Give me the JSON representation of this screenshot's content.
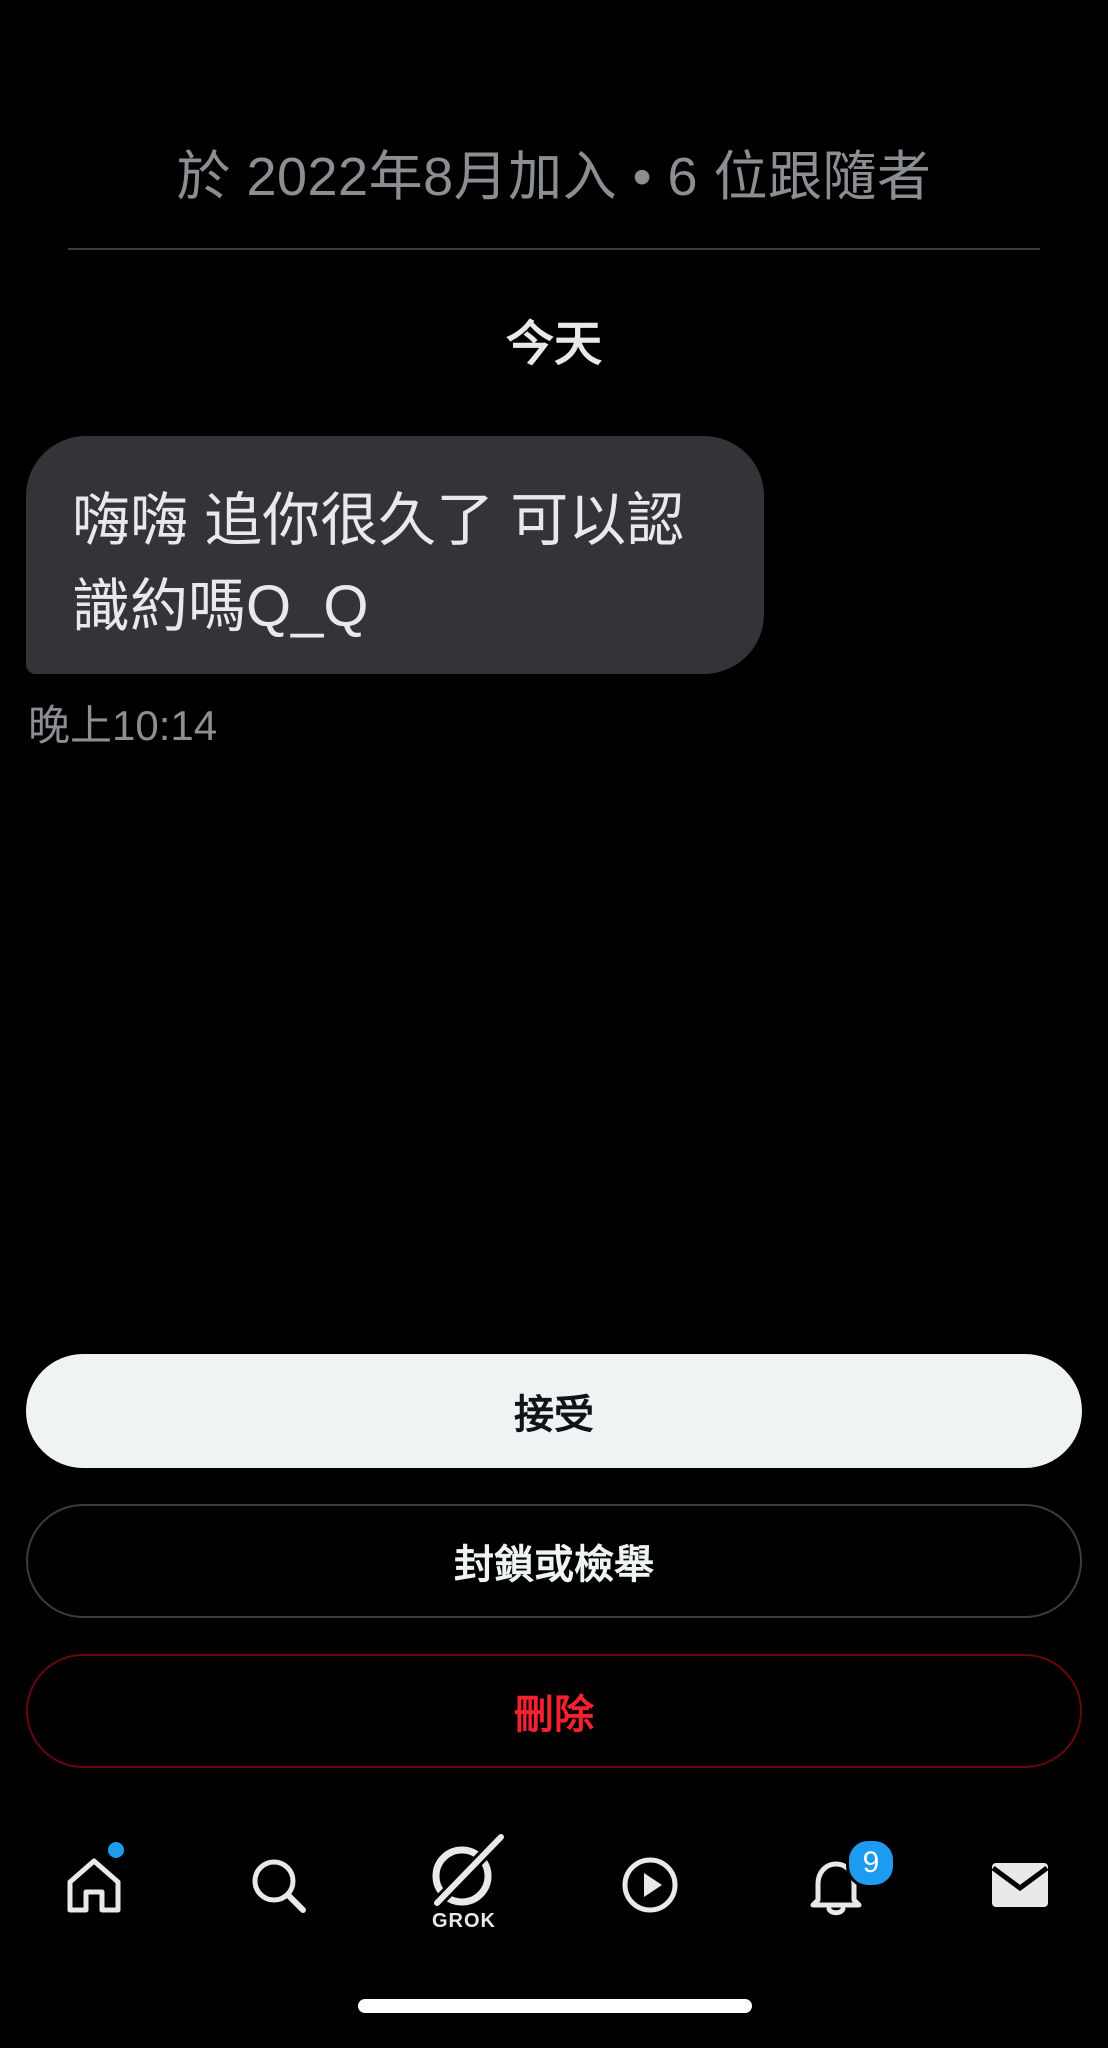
{
  "profile": {
    "meta": "於 2022年8月加入 • 6 位跟隨者"
  },
  "conversation": {
    "day_label": "今天",
    "message": {
      "text_line1": "嗨嗨 追你很久了 可以認",
      "text_line2": "識約嗎Q_Q",
      "time": "晚上10:14"
    }
  },
  "actions": {
    "accept": "接受",
    "block_report": "封鎖或檢舉",
    "delete": "刪除"
  },
  "tabbar": {
    "tabs": [
      {
        "icon": "home-icon",
        "has_dot": true
      },
      {
        "icon": "search-icon"
      },
      {
        "icon": "grok-icon",
        "label": "GROK"
      },
      {
        "icon": "play-icon"
      },
      {
        "icon": "bell-icon",
        "badge": "9"
      },
      {
        "icon": "mail-icon",
        "active": true
      }
    ]
  },
  "colors": {
    "accent": "#1d9bf0",
    "danger": "#f4212e",
    "bubble": "#333438",
    "muted": "#8b8e93"
  }
}
